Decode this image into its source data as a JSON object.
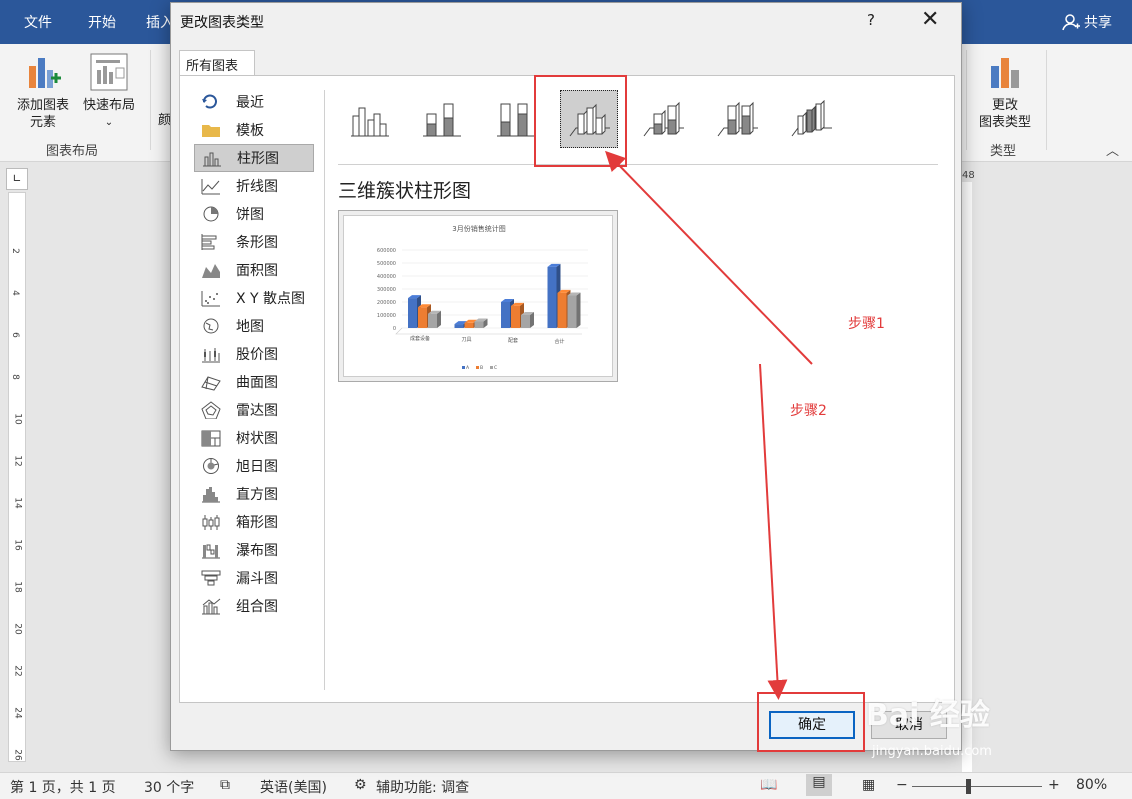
{
  "word": {
    "menu": [
      "文件",
      "开始",
      "插入"
    ],
    "share_label": "共享",
    "ribbon": {
      "add_element_line1": "添加图表",
      "add_element_line2": "元素",
      "quick_layout": "快速布局",
      "group_chart_layout": "图表布局",
      "change_type_line1": "更改",
      "change_type_line2": "图表类型",
      "group_type": "类型",
      "partial_char": "颜"
    },
    "ruler_numbers": [
      "2",
      "4",
      "6",
      "8",
      "10",
      "12",
      "14",
      "16",
      "18",
      "20",
      "22",
      "24",
      "26"
    ],
    "right_ruler_number": "48",
    "status": {
      "page": "第 1 页，共 1 页",
      "words": "30 个字",
      "language": "英语(美国)",
      "accessibility": "辅助功能: 调查",
      "zoom": "80%"
    }
  },
  "dialog": {
    "title": "更改图表类型",
    "help": "?",
    "close": "✕",
    "tab": "所有图表",
    "categories": [
      {
        "label": "最近",
        "icon": "recent-icon"
      },
      {
        "label": "模板",
        "icon": "folder-icon"
      },
      {
        "label": "柱形图",
        "icon": "column-chart-icon",
        "selected": true
      },
      {
        "label": "折线图",
        "icon": "line-chart-icon"
      },
      {
        "label": "饼图",
        "icon": "pie-chart-icon"
      },
      {
        "label": "条形图",
        "icon": "bar-chart-icon"
      },
      {
        "label": "面积图",
        "icon": "area-chart-icon"
      },
      {
        "label": "X Y 散点图",
        "icon": "scatter-chart-icon"
      },
      {
        "label": "地图",
        "icon": "map-chart-icon"
      },
      {
        "label": "股价图",
        "icon": "stock-chart-icon"
      },
      {
        "label": "曲面图",
        "icon": "surface-chart-icon"
      },
      {
        "label": "雷达图",
        "icon": "radar-chart-icon"
      },
      {
        "label": "树状图",
        "icon": "treemap-chart-icon"
      },
      {
        "label": "旭日图",
        "icon": "sunburst-chart-icon"
      },
      {
        "label": "直方图",
        "icon": "histogram-chart-icon"
      },
      {
        "label": "箱形图",
        "icon": "box-chart-icon"
      },
      {
        "label": "瀑布图",
        "icon": "waterfall-chart-icon"
      },
      {
        "label": "漏斗图",
        "icon": "funnel-chart-icon"
      },
      {
        "label": "组合图",
        "icon": "combo-chart-icon"
      }
    ],
    "subtypes_selected_index": 3,
    "chart_name": "三维簇状柱形图",
    "ok": "确定",
    "cancel": "取消"
  },
  "preview_chart": {
    "chart_data": {
      "type": "bar",
      "title": "3月份销售统计图",
      "categories": [
        "成套设备",
        "刀具",
        "配套",
        "合计"
      ],
      "series": [
        {
          "name": "A",
          "values": [
            230000,
            30000,
            200000,
            470000
          ]
        },
        {
          "name": "B",
          "values": [
            160000,
            40000,
            170000,
            270000
          ]
        },
        {
          "name": "C",
          "values": [
            110000,
            50000,
            100000,
            250000
          ]
        }
      ],
      "yticks": [
        "600000",
        "500000",
        "400000",
        "300000",
        "200000",
        "100000",
        "0"
      ],
      "ylim": [
        0,
        600000
      ],
      "legend": "bottom",
      "colors": [
        "#4472c4",
        "#ed7d31",
        "#a5a5a5"
      ]
    }
  },
  "annotations": {
    "step1": "步骤1",
    "step2": "步骤2",
    "color": "#e23b3b"
  },
  "watermark": {
    "text": "Bai 经验",
    "url": "jingyan.baidu.com"
  }
}
